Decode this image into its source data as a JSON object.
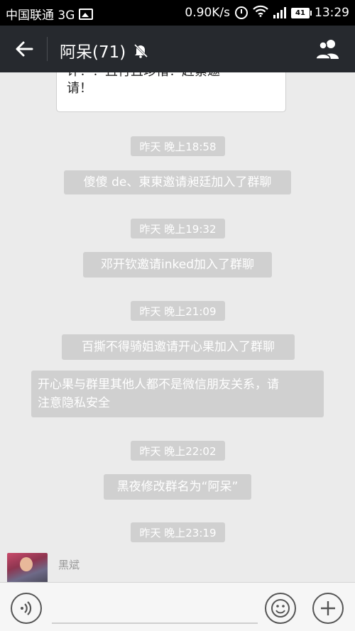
{
  "status_bar": {
    "carrier": "中国联通 3G",
    "speed": "0.90K/s",
    "battery": "41",
    "time": "13:29"
  },
  "header": {
    "title": "阿呆(71)"
  },
  "previous_bubble": {
    "line1": "许！！且行且珍惜！赶紧邀",
    "line2": "请！"
  },
  "messages": [
    {
      "type": "time",
      "text": "昨天 晚上18:58"
    },
    {
      "type": "system",
      "text": "傻傻 de、東東邀请昶廷加入了群聊"
    },
    {
      "type": "time",
      "text": "昨天 晚上19:32"
    },
    {
      "type": "system",
      "text": "邓开钦邀请inked加入了群聊"
    },
    {
      "type": "time",
      "text": "昨天 晚上21:09"
    },
    {
      "type": "system",
      "text": "百撕不得骑姐邀请开心果加入了群聊"
    },
    {
      "type": "system",
      "lines": [
        "开心果与群里其他人都不是微信朋友关系，请",
        "注意隐私安全"
      ]
    },
    {
      "type": "time",
      "text": "昨天 晚上22:02"
    },
    {
      "type": "system",
      "text": "黑夜修改群名为“阿呆”"
    },
    {
      "type": "time",
      "text": "昨天 晚上23:19"
    }
  ],
  "sender": {
    "name": "黑斌"
  },
  "icons": {
    "back": "arrow-left-icon",
    "mute": "bell-off-icon",
    "members": "group-members-icon",
    "voice": "voice-icon",
    "emoji": "emoji-icon",
    "plus": "plus-icon"
  }
}
